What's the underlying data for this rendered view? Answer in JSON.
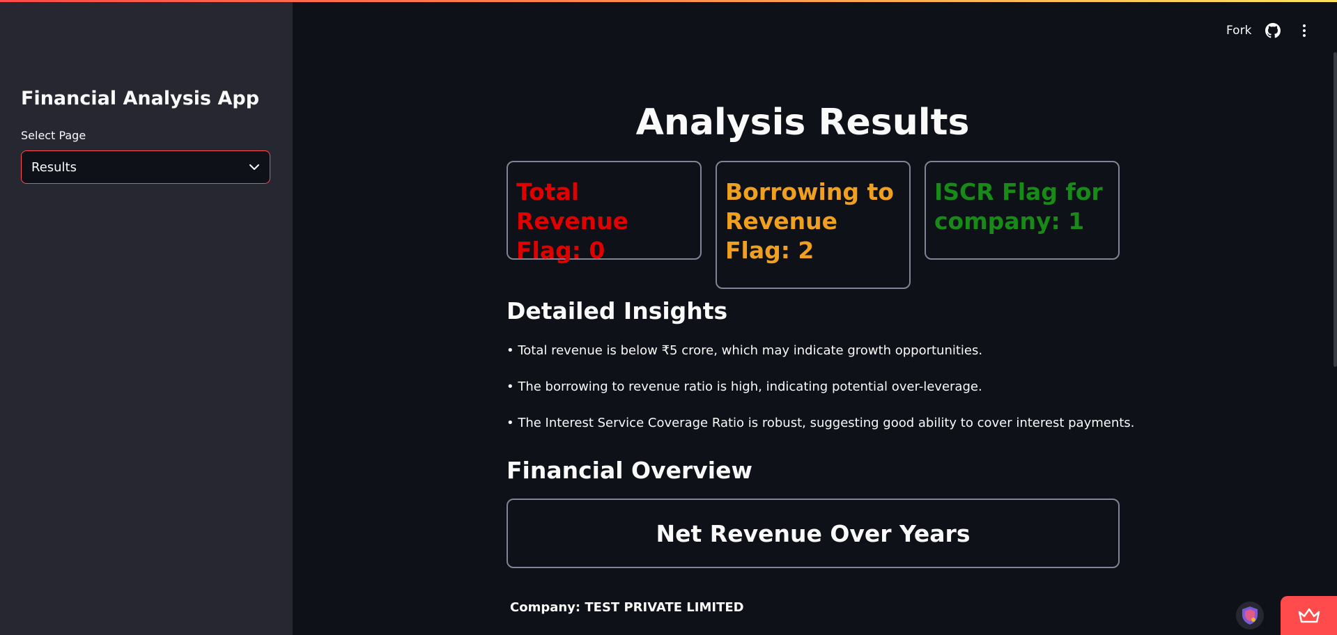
{
  "sidebar": {
    "title": "Financial Analysis App",
    "select_label": "Select Page",
    "select_value": "Results"
  },
  "header": {
    "fork_label": "Fork",
    "icons": [
      "github-icon",
      "kebab-menu-icon"
    ]
  },
  "main": {
    "title": "Analysis Results",
    "flags": [
      {
        "text": "Total Revenue Flag: 0",
        "color": "#e00000"
      },
      {
        "text": "Borrowing to Revenue Flag: 2",
        "color": "#f0a020"
      },
      {
        "text": "ISCR Flag for company: 1",
        "color": "#178a17"
      }
    ],
    "insights_heading": "Detailed Insights",
    "insights": [
      "• Total revenue is below ₹5 crore, which may indicate growth opportunities.",
      "• The borrowing to revenue ratio is high, indicating potential over-leverage.",
      "• The Interest Service Coverage Ratio is robust, suggesting good ability to cover interest payments."
    ],
    "overview_heading": "Financial Overview",
    "chart_title": "Net Revenue Over Years",
    "company": "Company: TEST PRIVATE LIMITED"
  },
  "colors": {
    "accent": "#ff4b4b",
    "background": "#0e1117",
    "sidebar": "#262730"
  }
}
